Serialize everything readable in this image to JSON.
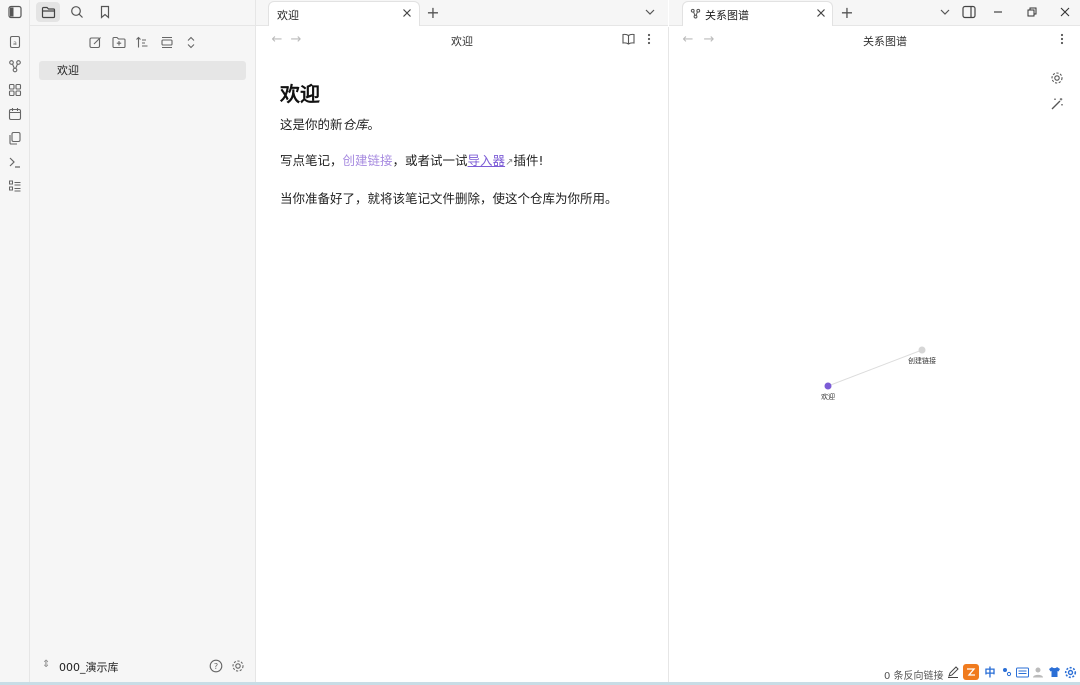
{
  "ribbon": {
    "icons": [
      "sidebar-toggle-icon",
      "file-icon",
      "graph-icon",
      "canvas-icon",
      "calendar-icon",
      "copy-icon",
      "terminal-icon",
      "list-icon"
    ]
  },
  "sidebar": {
    "tabs": [
      "folder-icon",
      "search-icon",
      "bookmark-icon"
    ],
    "tools": [
      "new-note-icon",
      "new-folder-icon",
      "sort-icon",
      "collapse-icon",
      "expand-icon"
    ],
    "files": [
      {
        "label": "欢迎"
      }
    ],
    "vault": {
      "name": "000_演示库"
    }
  },
  "left_pane": {
    "tab": {
      "label": "欢迎"
    },
    "title": "欢迎",
    "note": {
      "heading": "欢迎",
      "p1_prefix": "这是你的新",
      "p1_em": "仓库",
      "p1_suffix": "。",
      "p2_prefix": "写点笔记，",
      "p2_link": "创建链接",
      "p2_mid": "，或者试一试",
      "p2_ext": "导入器",
      "p2_suffix": "插件!",
      "p3": "当你准备好了，就将该笔记文件删除，使这个仓库为你所用。"
    }
  },
  "right_pane": {
    "tab": {
      "label": "关系图谱"
    },
    "title": "关系图谱",
    "graph": {
      "nodes": [
        {
          "label": "欢迎",
          "color": "#7c5cd6"
        },
        {
          "label": "创建链接",
          "color": "#d6d6d6"
        }
      ]
    }
  },
  "status": {
    "backlinks": "0 条反向链接"
  },
  "tray": {
    "ime": "中"
  },
  "colors": {
    "accent": "#7c5cd6",
    "link": "#a78be0"
  }
}
